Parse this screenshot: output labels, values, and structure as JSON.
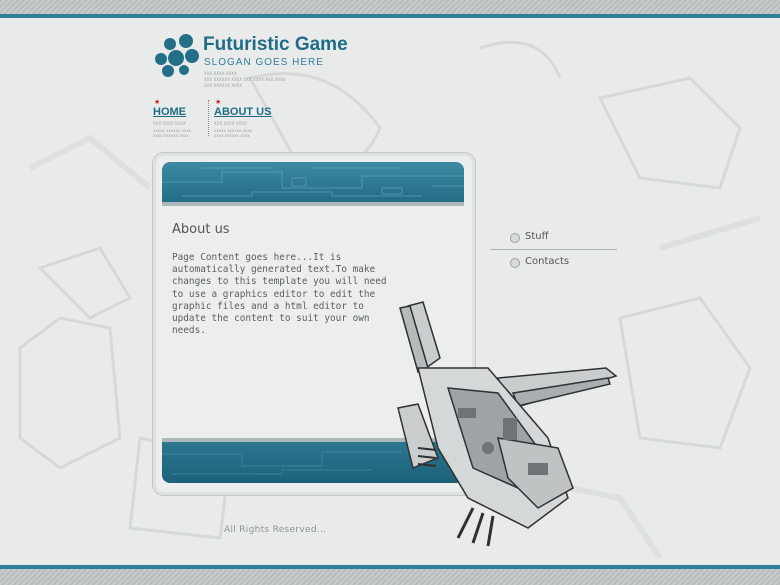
{
  "site": {
    "title": "Futuristic Game",
    "slogan": "SLOGAN GOES HERE",
    "logo_tiny_lines": [
      "XXX XXXX XXXX",
      "XXX XXXXXX XXXX XXX XXXX XXX XXXX",
      "XXX XXXXXX XXXX"
    ]
  },
  "nav": {
    "items": [
      {
        "label": "HOME",
        "sub": [
          "XXX XXXX XXXX",
          "xxxxx xxxxxx xxxx",
          "xxxx xxxxxx xxxx"
        ]
      },
      {
        "label": "ABOUT US",
        "sub": [
          "XXX XXXX XXXX",
          "xxxxx xxxxxx xxxx",
          "xxxx xxxxxx xxxx"
        ]
      }
    ]
  },
  "content": {
    "title": "About us",
    "body": "Page Content goes here...It is automatically generated text.To make changes to this template you will need to use a graphics editor to edit the graphic files and a html editor to update the content to suit your own needs."
  },
  "sidebar": {
    "items": [
      {
        "label": "Stuff"
      },
      {
        "label": "Contacts"
      }
    ]
  },
  "footer": {
    "text": "All Rights Reserved..."
  },
  "colors": {
    "accent": "#1f6c86",
    "stripe": "#2f7f98",
    "nav_star": "#c0262c"
  }
}
